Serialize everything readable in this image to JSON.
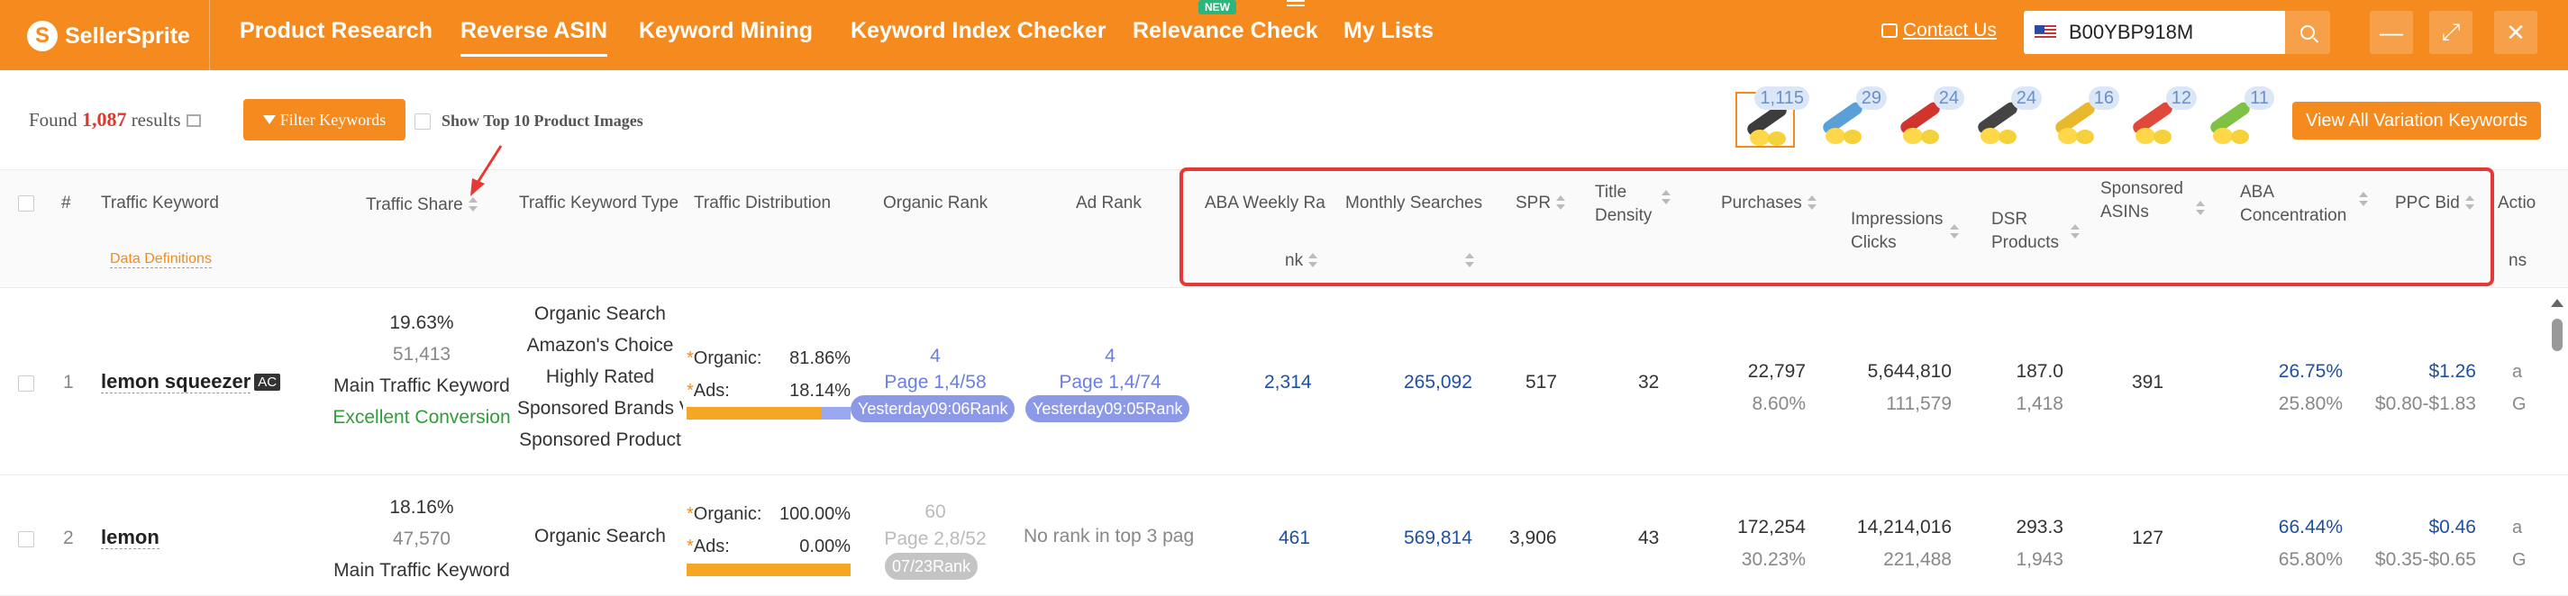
{
  "brand": {
    "name": "SellerSprite"
  },
  "nav": {
    "items": [
      "Product Research",
      "Reverse ASIN",
      "Keyword Mining",
      "Keyword Index Checker",
      "Relevance Check",
      "My Lists"
    ],
    "active_index": 1,
    "new_badge": "NEW",
    "contact": "Contact Us"
  },
  "search": {
    "value": "B00YBP918M"
  },
  "toolbar": {
    "found_prefix": "Found",
    "found_count": "1,087",
    "found_suffix": "results",
    "filter_label": "Filter Keywords",
    "show_top_label": "Show Top 10 Product Images",
    "variations_button": "View All Variation Keywords"
  },
  "variations": [
    {
      "count": "1,115",
      "color": "#3c3c3c"
    },
    {
      "count": "29",
      "color": "#5aa0d8"
    },
    {
      "count": "24",
      "color": "#d0342c"
    },
    {
      "count": "24",
      "color": "#444444"
    },
    {
      "count": "16",
      "color": "#e8b92c"
    },
    {
      "count": "12",
      "color": "#e0483a"
    },
    {
      "count": "11",
      "color": "#7dc243"
    }
  ],
  "columns": {
    "index": "#",
    "keyword": "Traffic Keyword",
    "data_definitions": "Data Definitions",
    "traffic_share": "Traffic Share",
    "keyword_type": "Traffic Keyword Type",
    "distribution": "Traffic Distribution",
    "organic_rank": "Organic Rank",
    "ad_rank": "Ad Rank",
    "aba_weekly_line1": "ABA Weekly Ra",
    "aba_weekly_line2": "nk",
    "monthly_searches": "Monthly Searches",
    "spr": "SPR",
    "title_density_1": "Title",
    "title_density_2": "Density",
    "purchases": "Purchases",
    "impressions": "Impressions",
    "clicks": "Clicks",
    "dsr": "DSR",
    "products": "Products",
    "sponsored_1": "Sponsored",
    "sponsored_2": "ASINs",
    "aba_conc_1": "ABA",
    "aba_conc_2": "Concentration",
    "ppc_bid": "PPC Bid",
    "actions_1": "Actio",
    "actions_2": "ns"
  },
  "rows": [
    {
      "index": "1",
      "keyword": "lemon squeezer",
      "badge": "AC",
      "share_pct": "19.63%",
      "share_num": "51,413",
      "share_label": "Main Traffic Keyword",
      "share_quality": "Excellent Conversion",
      "types": [
        "Organic Search",
        "Amazon's Choice",
        "Highly Rated",
        "Sponsored Brands V",
        "Sponsored Product"
      ],
      "organic_label": "Organic:",
      "organic_pct": "81.86%",
      "organic_share": 0.8186,
      "ads_label": "Ads:",
      "ads_pct": "18.14%",
      "organic_rank_main": "4",
      "organic_rank_page": "Page 1,4/58",
      "organic_rank_tag": "Yesterday09:06Rank",
      "ad_rank_main": "4",
      "ad_rank_page": "Page 1,4/74",
      "ad_rank_tag": "Yesterday09:05Rank",
      "aba": "2,314",
      "monthly": "265,092",
      "spr": "517",
      "title_density": "32",
      "purchases": "22,797",
      "purchases_pct": "8.60%",
      "impressions": "5,644,810",
      "clicks": "111,579",
      "dsr": "187.0",
      "products": "1,418",
      "sponsored": "391",
      "conc_1": "26.75%",
      "conc_2": "25.80%",
      "ppc": "$1.26",
      "ppc_range": "$0.80-$1.83"
    },
    {
      "index": "2",
      "keyword": "lemon",
      "share_pct": "18.16%",
      "share_num": "47,570",
      "share_label": "Main Traffic Keyword",
      "types": [
        "Organic Search"
      ],
      "organic_label": "Organic:",
      "organic_pct": "100.00%",
      "organic_share": 1.0,
      "ads_label": "Ads:",
      "ads_pct": "0.00%",
      "organic_rank_main": "60",
      "organic_rank_page": "Page 2,8/52",
      "organic_rank_tag": "07/23Rank",
      "ad_rank_text": "No rank in top 3 pag",
      "aba": "461",
      "monthly": "569,814",
      "spr": "3,906",
      "title_density": "43",
      "purchases": "172,254",
      "purchases_pct": "30.23%",
      "impressions": "14,214,016",
      "clicks": "221,488",
      "dsr": "293.3",
      "products": "1,943",
      "sponsored": "127",
      "conc_1": "66.44%",
      "conc_2": "65.80%",
      "ppc": "$0.46",
      "ppc_range": "$0.35-$0.65"
    }
  ],
  "action_icons": [
    "amazon-icon",
    "google-icon"
  ]
}
